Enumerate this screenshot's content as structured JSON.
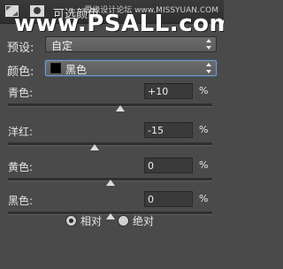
{
  "title_bar": {
    "title": "可选颜色",
    "icons": [
      "adjustment-layer-icon",
      "layer-mask-icon"
    ],
    "watermark_top": "思缘设计论坛 www.MISSYUAN.COM",
    "watermark_main": "www.PSALL.com"
  },
  "preset": {
    "label": "预设:",
    "value": "自定"
  },
  "colors": {
    "label": "颜色:",
    "value": "黑色",
    "swatch_color": "#000000"
  },
  "sliders": [
    {
      "label": "青色:",
      "value": "+10",
      "unit": "%",
      "level": 10
    },
    {
      "label": "洋红:",
      "value": "-15",
      "unit": "%",
      "level": -15
    },
    {
      "label": "黄色:",
      "value": "0",
      "unit": "%",
      "level": 0
    },
    {
      "label": "黑色:",
      "value": "0",
      "unit": "%",
      "level": 0
    }
  ],
  "method": {
    "options": [
      {
        "label": "相对",
        "selected": true
      },
      {
        "label": "绝对",
        "selected": false
      }
    ]
  }
}
